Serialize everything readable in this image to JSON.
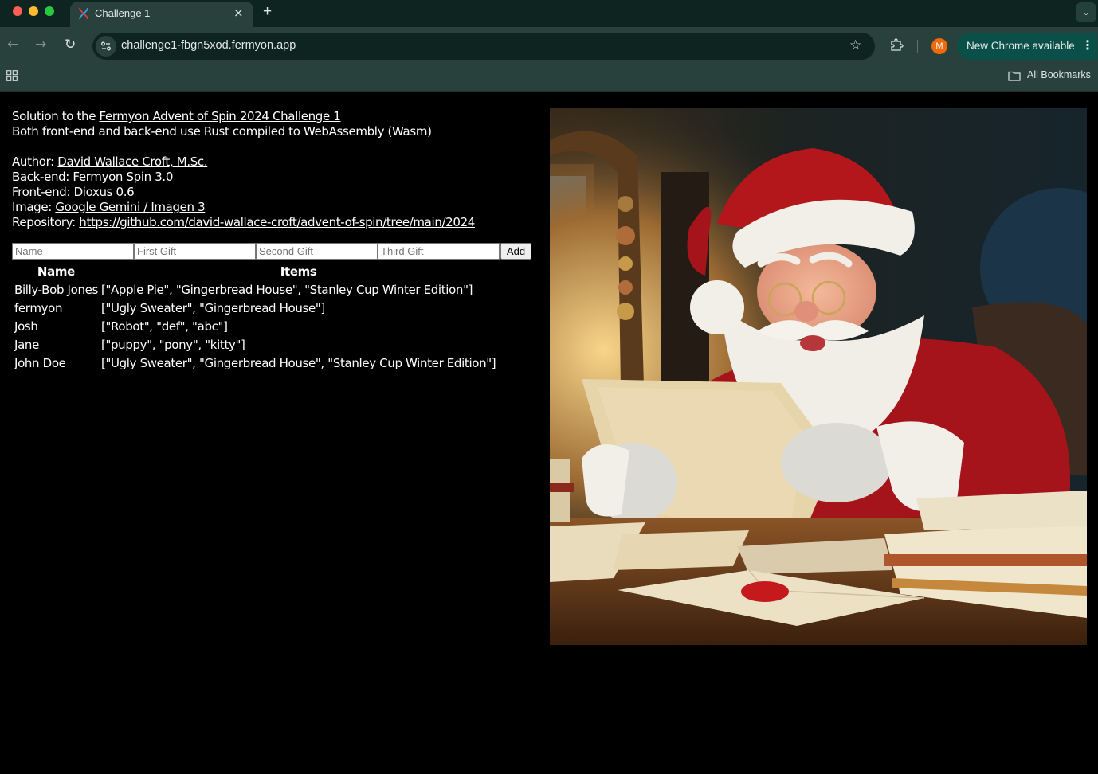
{
  "browser": {
    "tab": {
      "title": "Challenge 1",
      "close_glyph": "×",
      "favicon": "fermyon-dna-icon"
    },
    "new_tab_glyph": "+",
    "tab_search_glyph": "⌄",
    "nav": {
      "back_glyph": "←",
      "forward_glyph": "→",
      "reload_glyph": "↻"
    },
    "url": "challenge1-fbgn5xod.fermyon.app",
    "bookmark_star_glyph": "☆",
    "profile_initial": "M",
    "update_label": "New Chrome available",
    "update_menu_glyph": "⋮",
    "bookmarks_bar": {
      "all_bookmarks_label": "All Bookmarks"
    },
    "colors": {
      "tabbar": "#0e2420",
      "toolbar": "#29413d",
      "update_pill": "#0b5048",
      "avatar": "#f06a0c"
    }
  },
  "page": {
    "intro": {
      "prefix": "Solution to the ",
      "challenge_link": "Fermyon Advent of Spin 2024 Challenge 1",
      "subtitle": "Both front-end and back-end use Rust compiled to WebAssembly (Wasm)"
    },
    "credits": [
      {
        "label": "Author: ",
        "link": "David Wallace Croft, M.Sc."
      },
      {
        "label": "Back-end: ",
        "link": "Fermyon Spin 3.0"
      },
      {
        "label": "Front-end: ",
        "link": "Dioxus 0.6"
      },
      {
        "label": "Image: ",
        "link": "Google Gemini / Imagen 3"
      },
      {
        "label": "Repository: ",
        "link": "https://github.com/david-wallace-croft/advent-of-spin/tree/main/2024"
      }
    ],
    "form": {
      "name_placeholder": "Name",
      "first_gift_placeholder": "First Gift",
      "second_gift_placeholder": "Second Gift",
      "third_gift_placeholder": "Third Gift",
      "name_value": "",
      "first_gift_value": "",
      "second_gift_value": "",
      "third_gift_value": "",
      "add_label": "Add"
    },
    "table": {
      "headers": [
        "Name",
        "Items"
      ],
      "rows": [
        {
          "name": "Billy-Bob Jones",
          "items": "[\"Apple Pie\", \"Gingerbread House\", \"Stanley Cup Winter Edition\"]"
        },
        {
          "name": "fermyon",
          "items": "[\"Ugly Sweater\", \"Gingerbread House\"]"
        },
        {
          "name": "Josh",
          "items": "[\"Robot\", \"def\", \"abc\"]"
        },
        {
          "name": "Jane",
          "items": "[\"puppy\", \"pony\", \"kitty\"]"
        },
        {
          "name": "John Doe",
          "items": "[\"Ugly Sweater\", \"Gingerbread House\", \"Stanley Cup Winter Edition\"]"
        }
      ]
    },
    "image": {
      "description": "Illustration of Santa Claus reading a letter at a desk",
      "colors": {
        "santa_red": "#b3161b",
        "fur": "#f2efe8",
        "paper": "#e8d9b4",
        "wax_seal": "#c41a1e"
      }
    }
  }
}
